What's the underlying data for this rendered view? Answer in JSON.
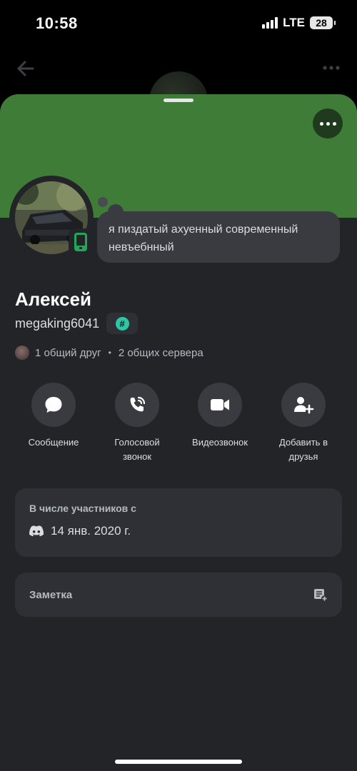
{
  "status_bar": {
    "time": "10:58",
    "network": "LTE",
    "battery": "28"
  },
  "nav": {
    "back_icon": "arrow-left-icon",
    "more_icon": "ellipsis-icon"
  },
  "theme": {
    "banner_color": "#3f7c37",
    "online_color": "#23a55a",
    "sheet_bg": "#232428"
  },
  "profile": {
    "display_name": "Алексей",
    "username": "megaking6041",
    "custom_status": "я пиздатый ахуенный современный невъебнный",
    "badge_icon": "hashtag-badge-icon",
    "badge_glyph": "#",
    "presence": "mobile-online"
  },
  "mutuals": {
    "friends": "1 общий друг",
    "separator": "•",
    "servers": "2 общих сервера"
  },
  "actions": [
    {
      "label": "Сообщение",
      "icon": "chat-bubble-icon"
    },
    {
      "label": "Голосовой звонок",
      "icon": "phone-call-icon"
    },
    {
      "label": "Видеозвонок",
      "icon": "video-camera-icon"
    },
    {
      "label": "Добавить в друзья",
      "icon": "add-friend-icon"
    }
  ],
  "member_since": {
    "title": "В числе участников с",
    "date": "14 янв. 2020 г.",
    "icon": "discord-logo-icon"
  },
  "note": {
    "label": "Заметка",
    "icon": "add-note-icon"
  }
}
